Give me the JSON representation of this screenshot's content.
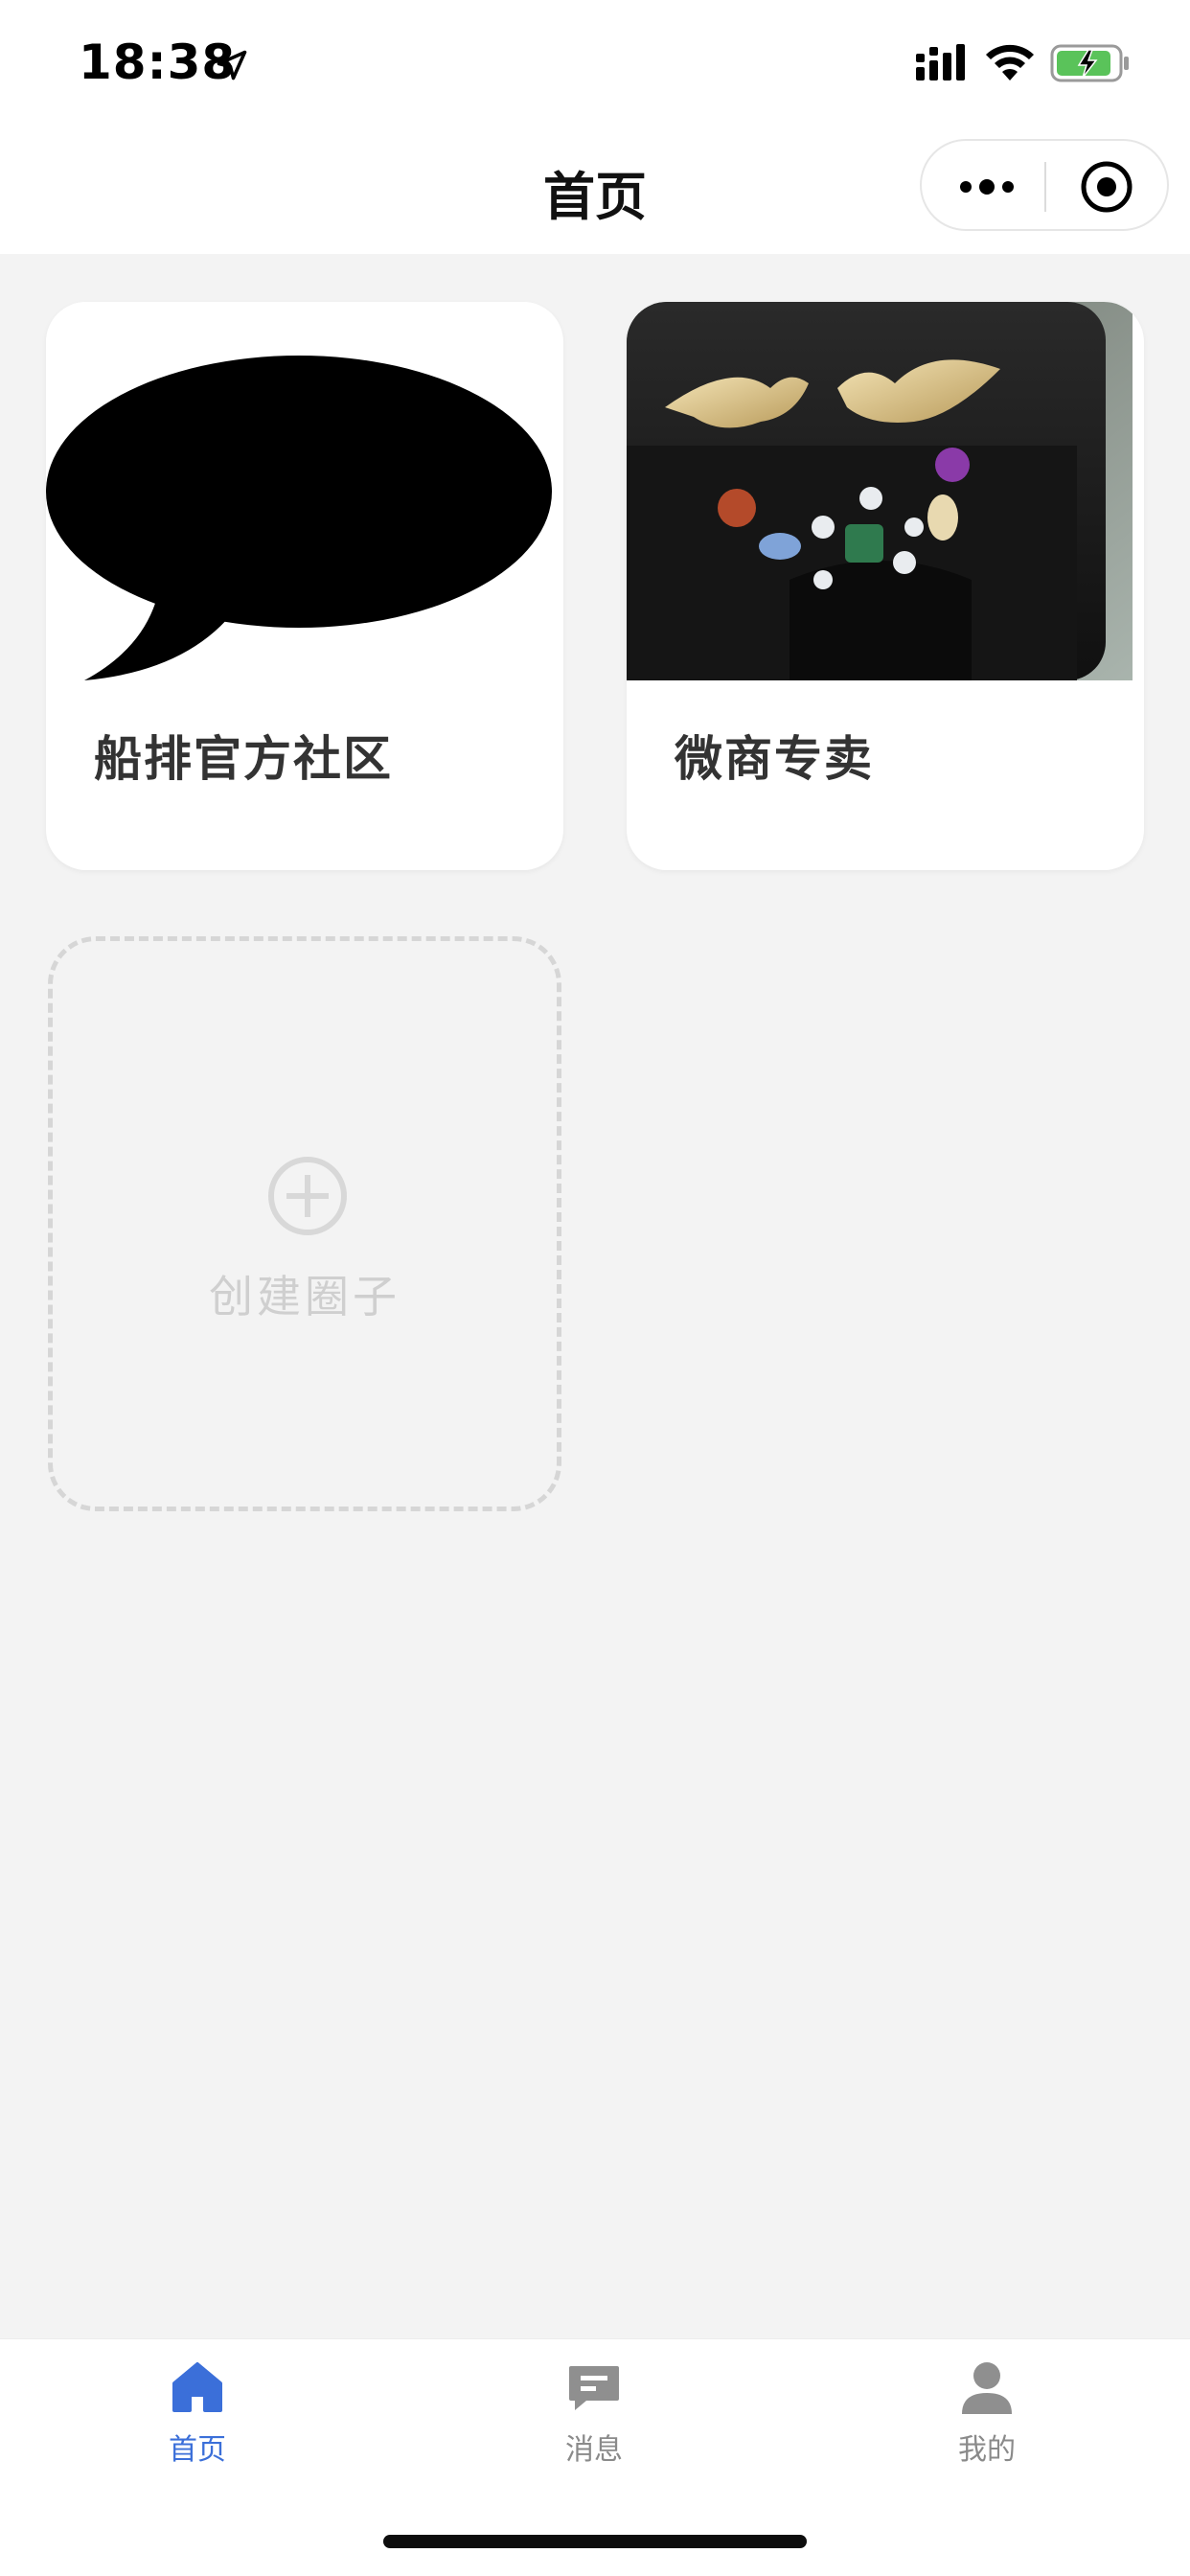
{
  "status_bar": {
    "time": "18:38"
  },
  "nav": {
    "title": "首页"
  },
  "cards": [
    {
      "title": "船排官方社区",
      "image": "speech-bubble-image"
    },
    {
      "title": "微商专卖",
      "image": "handbag-brooch-photo"
    }
  ],
  "create": {
    "label": "创建圈子"
  },
  "tabs": [
    {
      "label": "首页",
      "icon": "home-icon",
      "active": true
    },
    {
      "label": "消息",
      "icon": "message-icon",
      "active": false
    },
    {
      "label": "我的",
      "icon": "user-icon",
      "active": false
    }
  ],
  "colors": {
    "background": "#f3f3f3",
    "accent": "#3b6fd9",
    "tab_inactive": "#8a8a8a",
    "card_title": "#333333",
    "create_placeholder": "#cfcfcf"
  }
}
